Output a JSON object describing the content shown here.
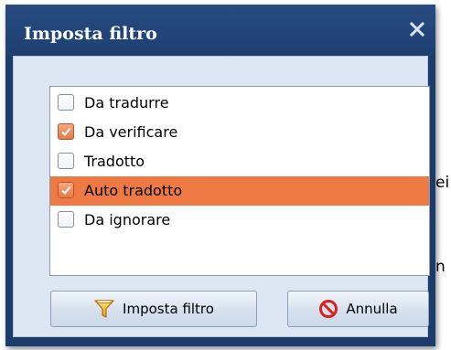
{
  "background_text": [
    "ei",
    "n"
  ],
  "dialog": {
    "title": "Imposta filtro",
    "close_icon": "close-x-icon",
    "items": [
      {
        "label": "Da tradurre",
        "checked": false,
        "selected": false
      },
      {
        "label": "Da verificare",
        "checked": true,
        "selected": false
      },
      {
        "label": "Tradotto",
        "checked": false,
        "selected": false
      },
      {
        "label": "Auto tradotto",
        "checked": true,
        "selected": true
      },
      {
        "label": "Da ignorare",
        "checked": false,
        "selected": false
      }
    ],
    "ok_button": {
      "label": "Imposta filtro",
      "icon": "funnel-icon"
    },
    "cancel_button": {
      "label": "Annulla",
      "icon": "no-entry-icon"
    }
  },
  "colors": {
    "title_bar": "#1e3f70",
    "selection": "#ef7942",
    "client_bg": "#dde7f3"
  }
}
